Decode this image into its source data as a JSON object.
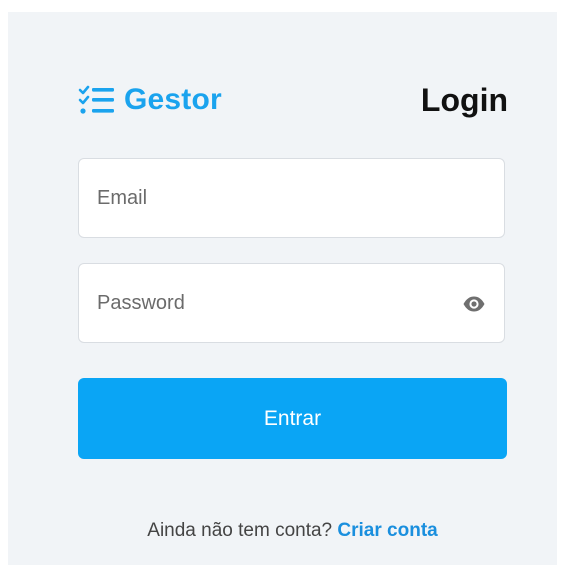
{
  "brand": {
    "icon": "checklist-icon",
    "name": "Gestor",
    "color": "#1aa3ee"
  },
  "title": "Login",
  "form": {
    "email": {
      "placeholder": "Email",
      "value": ""
    },
    "password": {
      "placeholder": "Password",
      "value": "",
      "toggle_icon": "eye-icon"
    },
    "submit_label": "Entrar",
    "submit_color": "#0aa5f5"
  },
  "signup": {
    "prompt": "Ainda não tem conta?",
    "link_label": "Criar conta",
    "link_color": "#1a8fde"
  },
  "background_color": "#f1f4f7"
}
